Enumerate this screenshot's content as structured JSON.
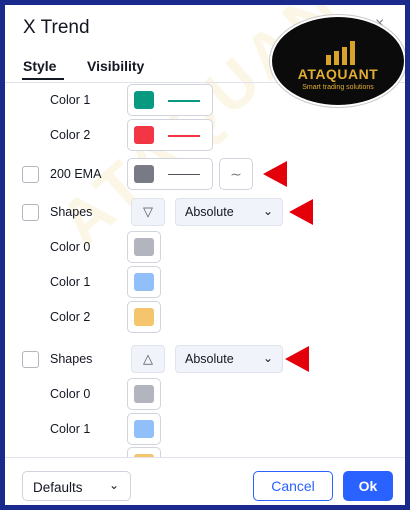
{
  "dialog": {
    "title": "X Trend",
    "close_glyph": "×"
  },
  "tabs": [
    {
      "label": "Style",
      "active": true
    },
    {
      "label": "Visibility",
      "active": false
    }
  ],
  "rows": {
    "color1_top": {
      "label": "Color 1",
      "color": "#089981"
    },
    "color2_top": {
      "label": "Color 2",
      "color": "#f23645"
    },
    "ema": {
      "label": "200 EMA",
      "color": "#787b86",
      "checked": false
    },
    "shapes1": {
      "label": "Shapes",
      "shape_glyph": "▽",
      "select_value": "Absolute",
      "checked": false
    },
    "s1_color0": {
      "label": "Color 0",
      "color": "#b2b5be"
    },
    "s1_color1": {
      "label": "Color 1",
      "color": "#90bff9"
    },
    "s1_color2": {
      "label": "Color 2",
      "color": "#f5c56e"
    },
    "shapes2": {
      "label": "Shapes",
      "shape_glyph": "△",
      "select_value": "Absolute",
      "checked": false
    },
    "s2_color0": {
      "label": "Color 0",
      "color": "#b2b5be"
    },
    "s2_color1": {
      "label": "Color 1",
      "color": "#90bff9"
    },
    "s2_color2": {
      "color": "#f5c56e"
    }
  },
  "footer": {
    "defaults_label": "Defaults",
    "cancel_label": "Cancel",
    "ok_label": "Ok"
  },
  "icons": {
    "chevron": "chevron-down-icon",
    "wave": "wave-icon",
    "annotation_arrow": "red-arrow-icon"
  },
  "colors": {
    "accent": "#2962ff",
    "annotation": "#e3000b",
    "frame": "#1a2a8c"
  },
  "logo": {
    "name": "ATAQUANT",
    "tagline": "Smart trading solutions"
  },
  "watermark": "ATAQUANT"
}
